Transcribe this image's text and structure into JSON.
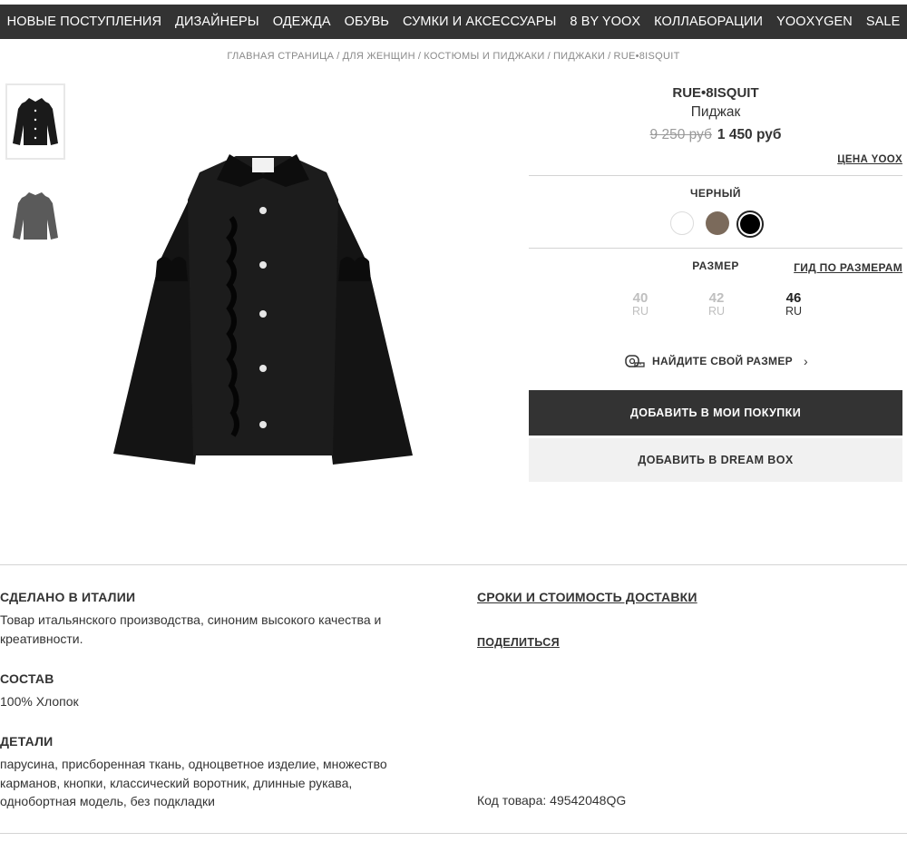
{
  "nav": {
    "items": [
      "НОВЫЕ ПОСТУПЛЕНИЯ",
      "ДИЗАЙНЕРЫ",
      "ОДЕЖДА",
      "ОБУВЬ",
      "СУМКИ И АКСЕССУАРЫ",
      "8 BY YOOX",
      "КОЛЛАБОРАЦИИ",
      "YOOXYGEN",
      "SALE"
    ]
  },
  "breadcrumb": {
    "items": [
      "ГЛАВНАЯ СТРАНИЦА",
      "ДЛЯ ЖЕНЩИН",
      "КОСТЮМЫ И ПИДЖАКИ",
      "ПИДЖАКИ",
      "RUE•8ISQUIT"
    ],
    "separator": "/"
  },
  "product": {
    "brand": "RUE•8ISQUIT",
    "category": "Пиджак",
    "old_price": "9 250 руб",
    "new_price": "1 450 руб",
    "yoox_price_label": "ЦЕНА YOOX",
    "color_label": "ЧЕРНЫЙ",
    "colors": [
      {
        "name": "white",
        "hex": "#ffffff"
      },
      {
        "name": "brown",
        "hex": "#7b6a5b"
      },
      {
        "name": "black",
        "hex": "#000000",
        "selected": true
      }
    ],
    "size_title": "РАЗМЕР",
    "size_guide_label": "ГИД ПО РАЗМЕРАМ",
    "sizes": [
      {
        "value": "40",
        "unit": "RU",
        "available": false
      },
      {
        "value": "42",
        "unit": "RU",
        "available": false
      },
      {
        "value": "46",
        "unit": "RU",
        "available": true
      }
    ],
    "find_size_label": "НАЙДИТЕ СВОЙ РАЗМЕР",
    "add_to_cart_label": "ДОБАВИТЬ В МОИ ПОКУПКИ",
    "add_to_dreambox_label": "ДОБАВИТЬ В DREAM BOX"
  },
  "details": {
    "made_in_title": "СДЕЛАНО В ИТАЛИИ",
    "made_in_text": "Товар итальянского производства, синоним высокого качества и креативности.",
    "composition_title": "СОСТАВ",
    "composition_text": "100% Хлопок",
    "details_title": "ДЕТАЛИ",
    "details_text": "парусина, присборенная ткань, одноцветное изделие, множество карманов, кнопки, классический воротник, длинные рукава, однобортная модель, без подкладки",
    "delivery_label": "СРОКИ И СТОИМОСТЬ ДОСТАВКИ",
    "share_label": "ПОДЕЛИТЬСЯ",
    "product_code": "Код товара: 49542048QG"
  },
  "colors": {
    "nav_bg": "#333333",
    "primary_button": "#333333",
    "secondary_button": "#f1f1f1",
    "muted_text": "#8a8a8a"
  }
}
